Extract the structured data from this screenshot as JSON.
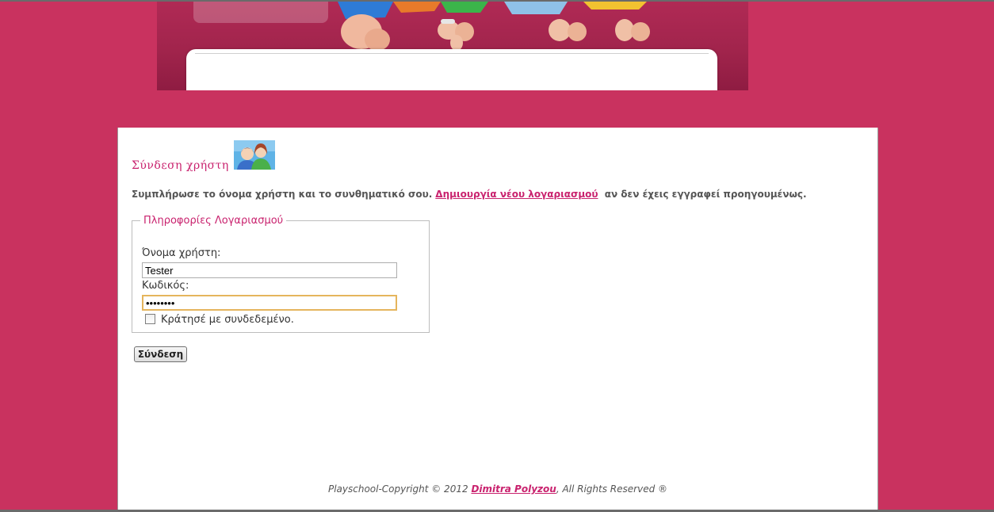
{
  "login": {
    "title": "Σύνδεση χρήστη",
    "instructions_before": "Συμπλήρωσε το όνομα χρήστη και το συνθηματικό σου.",
    "create_account_link": "Δημιουργία νέου λογαριασμού",
    "instructions_after": "αν δεν έχεις εγγραφεί προηγουμένως.",
    "fieldset_legend": "Πληροφορίες Λογαριασμού",
    "username_label": "Όνομα χρήστη:",
    "username_value": "Tester",
    "password_label": "Κωδικός:",
    "password_value": "••••••••",
    "remember_label": "Κράτησέ με συνδεδεμένο.",
    "remember_checked": false,
    "submit_label": "Σύνδεση"
  },
  "footer": {
    "prefix": "Playschool-Copyright © 2012",
    "author_link": "Dimitra Polyzou",
    "suffix": ", All Rights Reserved ®"
  },
  "colors": {
    "page_background": "#c9325f",
    "accent": "#c9226e"
  },
  "icons": {
    "login_icon": "users-icon"
  }
}
